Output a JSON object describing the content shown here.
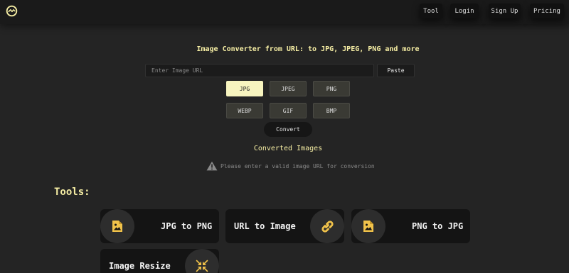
{
  "header": {
    "logo_icon": "wave-circle-icon",
    "nav": [
      "Tool",
      "Login",
      "Sign Up",
      "Pricing"
    ]
  },
  "main": {
    "title": "Image Converter from URL: to JPG, JPEG, PNG and more",
    "url_placeholder": "Enter Image URL",
    "url_value": "",
    "paste_label": "Paste",
    "formats": [
      "JPG",
      "JPEG",
      "PNG",
      "WEBP",
      "GIF",
      "BMP"
    ],
    "selected_format": "JPG",
    "convert_label": "Convert",
    "converted_title": "Converted Images",
    "warning_icon": "warning-triangle-icon",
    "warning_text": "Please enter a valid image URL for conversion"
  },
  "tools": {
    "heading": "Tools:",
    "items": [
      {
        "label": "JPG to PNG",
        "icon": "image-file-icon"
      },
      {
        "label": "URL to Image",
        "icon": "link-icon"
      },
      {
        "label": "PNG to JPG",
        "icon": "image-file-icon"
      },
      {
        "label": "Image Resize",
        "icon": "compress-arrows-icon"
      }
    ]
  },
  "colors": {
    "accent": "#f6eea4",
    "icon": "#f0c24a",
    "background": "#242424",
    "selected_format_bg": "#f7f4bf"
  }
}
